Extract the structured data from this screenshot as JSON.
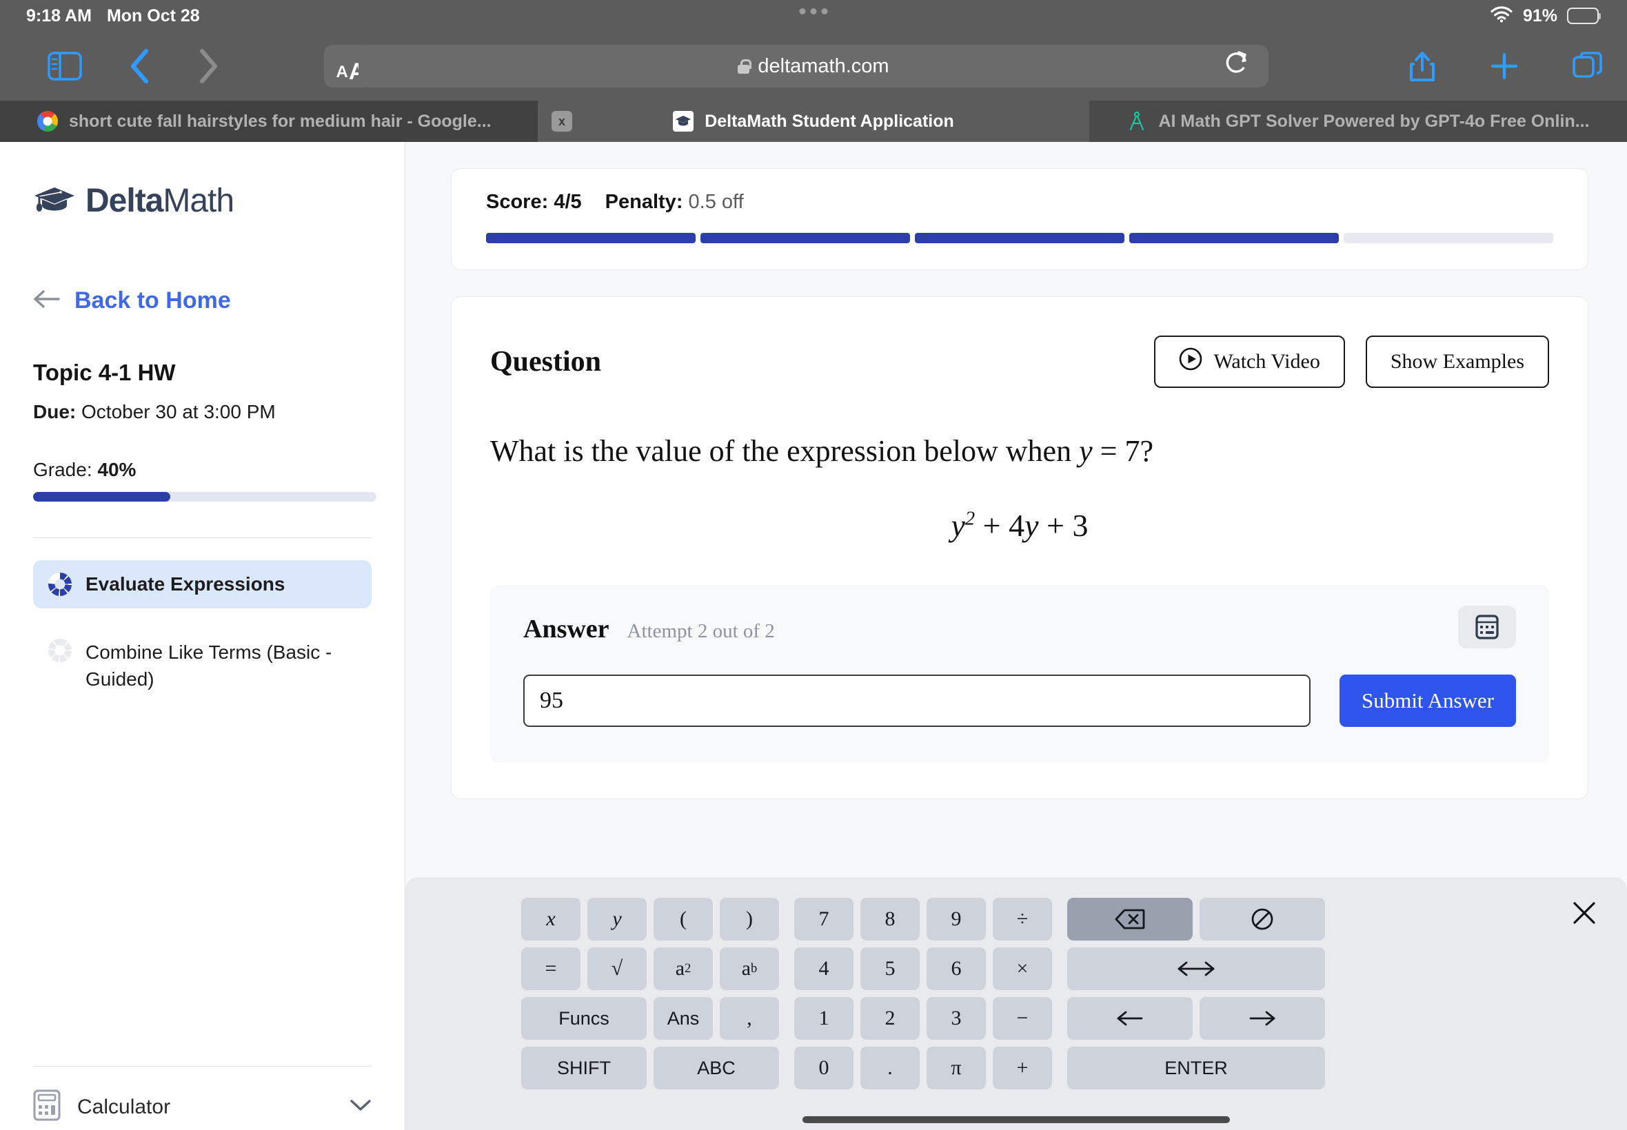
{
  "status_bar": {
    "time": "9:18 AM",
    "date": "Mon Oct 28",
    "battery_percent": "91%",
    "wifi_icon": "wifi-icon",
    "battery_icon": "battery-icon"
  },
  "browser": {
    "url": "deltamath.com",
    "text_size_small": "A",
    "text_size_large": "A",
    "icons": {
      "sidebar": "sidebar-toggle-icon",
      "back": "chevron-left-icon",
      "forward": "chevron-right-icon",
      "reload": "reload-icon",
      "share": "share-icon",
      "new_tab": "plus-icon",
      "tabs": "tab-overview-icon",
      "lock": "lock-icon"
    },
    "tabs": [
      {
        "title": "short cute fall hairstyles for medium hair - Google...",
        "favicon": "google-icon",
        "active": false
      },
      {
        "title": "DeltaMath Student Application",
        "favicon": "deltamath-icon",
        "active": true,
        "close_label": "x"
      },
      {
        "title": "AI Math GPT Solver Powered by GPT-4o Free Onlin...",
        "favicon": "compass-icon",
        "active": false
      }
    ]
  },
  "sidebar": {
    "logo_bold": "Delta",
    "logo_light": "Math",
    "back_label": "Back to Home",
    "assignment_title": "Topic 4-1 HW",
    "due_label": "Due:",
    "due_value": "October 30 at 3:00 PM",
    "grade_label": "Grade:",
    "grade_value": "40%",
    "grade_percent": 40,
    "items": [
      {
        "label": "Evaluate Expressions",
        "active": true,
        "progress": 78
      },
      {
        "label": "Combine Like Terms (Basic - Guided)",
        "active": false,
        "progress": 0
      }
    ],
    "calculator_label": "Calculator",
    "calculator_chevron": "chevron-down-icon"
  },
  "score": {
    "score_label": "Score:",
    "score_value": "4/5",
    "penalty_label": "Penalty:",
    "penalty_value": "0.5 off",
    "segments_total": 5,
    "segments_filled": 4
  },
  "question": {
    "heading": "Question",
    "watch_video_label": "Watch Video",
    "watch_video_icon": "play-circle-icon",
    "show_examples_label": "Show Examples",
    "prompt_part1": "What is the value of the expression below when",
    "prompt_var": "y",
    "prompt_eq": "=",
    "prompt_value": "7?",
    "expression": {
      "base_var": "y",
      "exponent": "2",
      "plus1": "+",
      "coef": "4",
      "var2": "y",
      "plus2": "+",
      "const": "3",
      "plain": "y^2 + 4y + 3"
    }
  },
  "answer": {
    "title": "Answer",
    "attempt_text": "Attempt 2 out of 2",
    "keyboard_toggle_icon": "keyboard-icon",
    "input_value": "95",
    "input_placeholder": "",
    "submit_label": "Submit Answer"
  },
  "math_keyboard": {
    "close_icon": "close-icon",
    "left_rows": [
      [
        {
          "label": "x",
          "name": "key-x",
          "style": "italic",
          "width": 1
        },
        {
          "label": "y",
          "name": "key-y",
          "style": "italic",
          "width": 1
        },
        {
          "label": "(",
          "name": "key-open-paren",
          "style": "serif",
          "width": 1
        },
        {
          "label": ")",
          "name": "key-close-paren",
          "style": "serif",
          "width": 1
        }
      ],
      [
        {
          "label": "=",
          "name": "key-equals",
          "style": "serif",
          "width": 1
        },
        {
          "label": "√",
          "name": "key-sqrt",
          "style": "serif",
          "width": 1
        },
        {
          "label": "a2",
          "name": "key-a-squared",
          "style": "sup",
          "width": 1
        },
        {
          "label": "ab",
          "name": "key-a-to-the-b",
          "style": "sup",
          "width": 1
        }
      ],
      [
        {
          "label": "Funcs",
          "name": "key-funcs",
          "style": "sans",
          "width": 2
        },
        {
          "label": "Ans",
          "name": "key-ans",
          "style": "sans",
          "width": 1
        },
        {
          "label": ",",
          "name": "key-comma",
          "style": "serif",
          "width": 1
        }
      ],
      [
        {
          "label": "SHIFT",
          "name": "key-shift",
          "style": "sans",
          "width": 2
        },
        {
          "label": "ABC",
          "name": "key-abc",
          "style": "sans",
          "width": 2
        }
      ]
    ],
    "numpad_rows": [
      [
        {
          "label": "7",
          "name": "key-7"
        },
        {
          "label": "8",
          "name": "key-8"
        },
        {
          "label": "9",
          "name": "key-9"
        },
        {
          "label": "÷",
          "name": "key-divide"
        }
      ],
      [
        {
          "label": "4",
          "name": "key-4"
        },
        {
          "label": "5",
          "name": "key-5"
        },
        {
          "label": "6",
          "name": "key-6"
        },
        {
          "label": "×",
          "name": "key-multiply"
        }
      ],
      [
        {
          "label": "1",
          "name": "key-1"
        },
        {
          "label": "2",
          "name": "key-2"
        },
        {
          "label": "3",
          "name": "key-3"
        },
        {
          "label": "−",
          "name": "key-minus"
        }
      ],
      [
        {
          "label": "0",
          "name": "key-0"
        },
        {
          "label": ".",
          "name": "key-decimal"
        },
        {
          "label": "π",
          "name": "key-pi"
        },
        {
          "label": "+",
          "name": "key-plus"
        }
      ]
    ],
    "right_keys": {
      "backspace": {
        "label": "⌫",
        "name": "key-backspace",
        "highlighted": true
      },
      "clear": {
        "label": "⃠",
        "name": "key-clear"
      },
      "resize": {
        "label": "⟷",
        "name": "key-resize"
      },
      "arrow_left": {
        "label": "←",
        "name": "key-arrow-left"
      },
      "arrow_right": {
        "label": "→",
        "name": "key-arrow-right"
      },
      "enter": {
        "label": "ENTER",
        "name": "key-enter"
      }
    }
  },
  "colors": {
    "accent_blue": "#2f54eb",
    "deltamath_navy": "#2c3ea8",
    "link_blue": "#4169e1",
    "chrome_gray": "#5c5c5c",
    "key_gray": "#ced2da",
    "key_highlight": "#9aa0ad"
  }
}
